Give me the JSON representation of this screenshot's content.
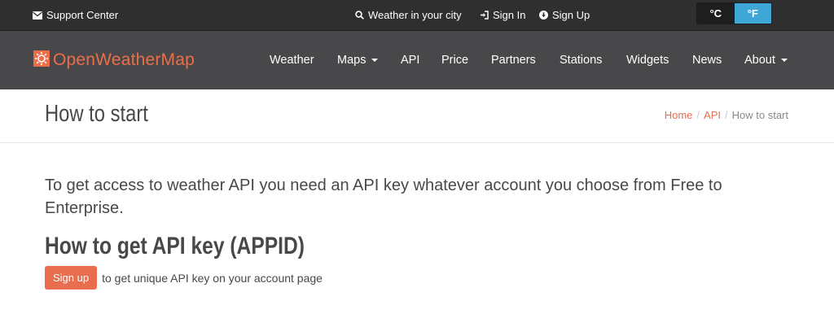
{
  "topbar": {
    "support": "Support Center",
    "weather_city": "Weather in your city",
    "sign_in": "Sign In",
    "sign_up": "Sign Up",
    "unit_c": "°C",
    "unit_f": "°F"
  },
  "nav": {
    "logo": "OpenWeatherMap",
    "items": [
      {
        "label": "Weather"
      },
      {
        "label": "Maps"
      },
      {
        "label": "API"
      },
      {
        "label": "Price"
      },
      {
        "label": "Partners"
      },
      {
        "label": "Stations"
      },
      {
        "label": "Widgets"
      },
      {
        "label": "News"
      },
      {
        "label": "About"
      }
    ]
  },
  "header": {
    "title": "How to start",
    "breadcrumb": [
      "Home",
      "API",
      "How to start"
    ],
    "separator": "/"
  },
  "main": {
    "lead": "To get access to weather API you need an API key whatever account you choose from Free to Enterprise.",
    "section_title": "How to get API key (APPID)",
    "signup_button": "Sign up",
    "signup_text": "to get unique API key on your account page"
  },
  "colors": {
    "accent": "#e96e50",
    "topbar_bg": "#2f2f2f",
    "navbar_bg": "#48484a",
    "unit_active": "#3fa6d8"
  }
}
